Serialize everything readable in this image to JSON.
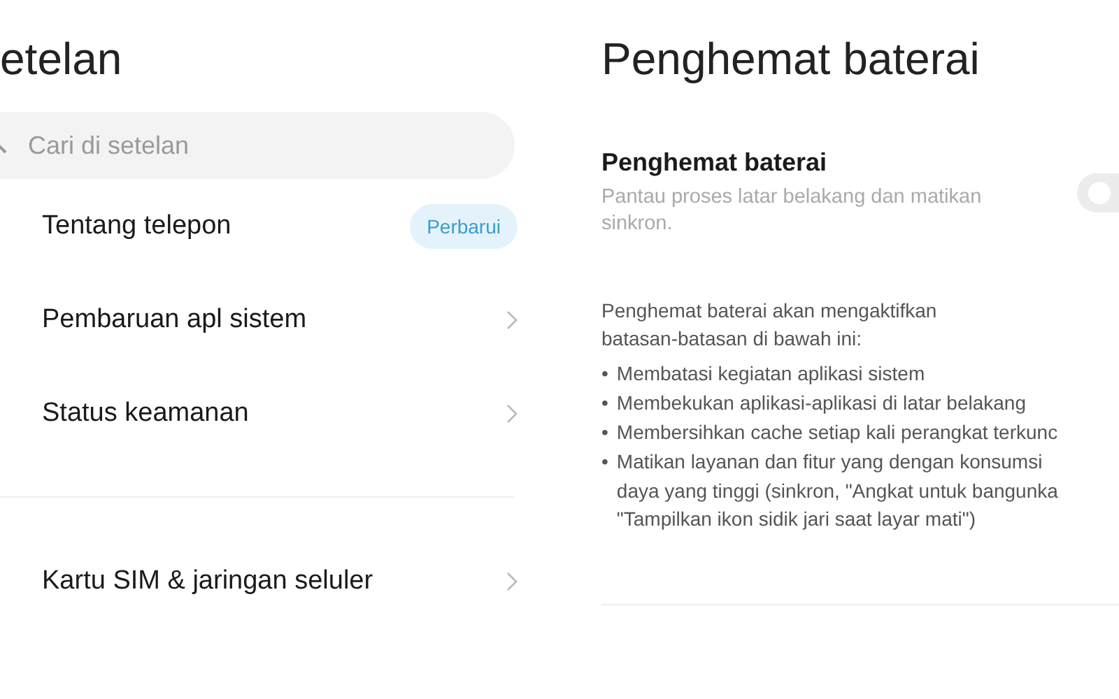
{
  "settings": {
    "title": "etelan",
    "search": {
      "placeholder": "Cari di setelan"
    },
    "items": [
      {
        "label": "Tentang telepon",
        "kind": "badge",
        "badge": "Perbarui"
      },
      {
        "label": "Pembaruan apl sistem",
        "kind": "chevron"
      },
      {
        "label": "Status keamanan",
        "kind": "chevron"
      },
      {
        "kind": "divider"
      },
      {
        "label": "Kartu SIM & jaringan seluler",
        "kind": "chevron"
      }
    ]
  },
  "battery_saver": {
    "title": "Penghemat baterai",
    "toggle": {
      "label": "Penghemat baterai",
      "description": "Pantau proses latar belakang dan matikan sinkron.",
      "on": false
    },
    "intro": "Penghemat baterai akan mengaktifkan batasan-batasan di bawah ini:",
    "restrictions": [
      {
        "bullet": "•",
        "lines": [
          "Membatasi kegiatan aplikasi sistem"
        ]
      },
      {
        "bullet": "•",
        "lines": [
          "Membekukan aplikasi-aplikasi di latar belakang"
        ]
      },
      {
        "bullet": "•",
        "lines": [
          "Membersihkan cache setiap kali perangkat terkunc"
        ]
      },
      {
        "bullet": "•",
        "lines": [
          "Matikan layanan dan fitur yang dengan konsumsi",
          "daya yang tinggi (sinkron, \"Angkat untuk bangunka",
          "\"Tampilkan ikon sidik jari saat layar mati\")"
        ]
      }
    ]
  }
}
